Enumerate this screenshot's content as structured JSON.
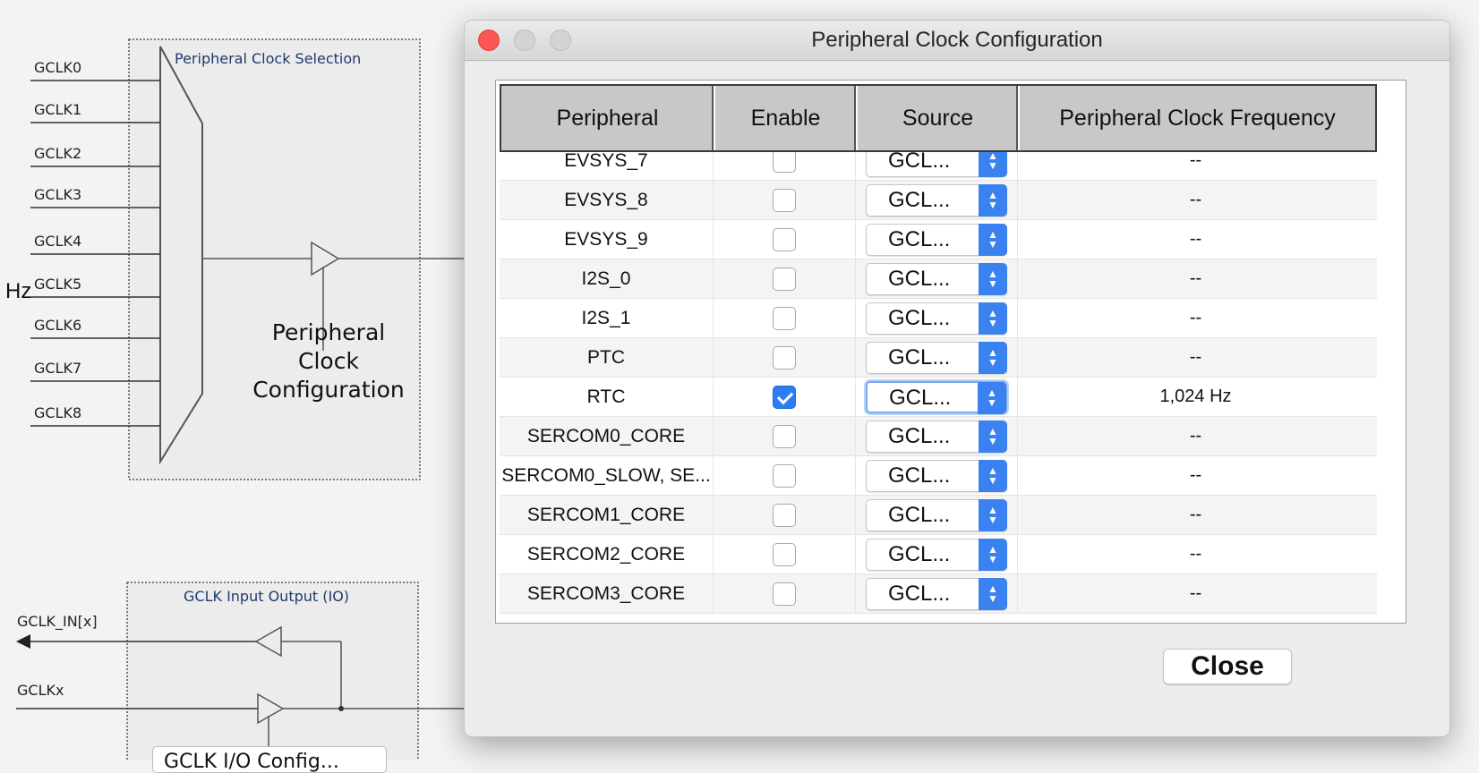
{
  "diagram": {
    "gclk_inputs": [
      "GCLK0",
      "GCLK1",
      "GCLK2",
      "GCLK3",
      "GCLK4",
      "GCLK5",
      "GCLK6",
      "GCLK7",
      "GCLK8"
    ],
    "selection_title": "Peripheral Clock Selection",
    "config_label_line1": "Peripheral",
    "config_label_line2": "Clock",
    "config_label_line3": "Configuration",
    "hz_fragment": "Hz",
    "io_title": "GCLK Input Output (IO)",
    "io_in_label": "GCLK_IN[x]",
    "io_out_label": "GCLKx",
    "io_config_button": "GCLK I/O Config..."
  },
  "dialog": {
    "title": "Peripheral Clock Configuration",
    "close_button": "Close",
    "columns": {
      "peripheral": "Peripheral",
      "enable": "Enable",
      "source": "Source",
      "frequency": "Peripheral Clock Frequency"
    },
    "rows": [
      {
        "peripheral": "EVSYS_7",
        "enabled": false,
        "source": "GCL...",
        "frequency": "--"
      },
      {
        "peripheral": "EVSYS_8",
        "enabled": false,
        "source": "GCL...",
        "frequency": "--"
      },
      {
        "peripheral": "EVSYS_9",
        "enabled": false,
        "source": "GCL...",
        "frequency": "--"
      },
      {
        "peripheral": "I2S_0",
        "enabled": false,
        "source": "GCL...",
        "frequency": "--"
      },
      {
        "peripheral": "I2S_1",
        "enabled": false,
        "source": "GCL...",
        "frequency": "--"
      },
      {
        "peripheral": "PTC",
        "enabled": false,
        "source": "GCL...",
        "frequency": "--"
      },
      {
        "peripheral": "RTC",
        "enabled": true,
        "source": "GCL...",
        "frequency": "1,024 Hz"
      },
      {
        "peripheral": "SERCOM0_CORE",
        "enabled": false,
        "source": "GCL...",
        "frequency": "--"
      },
      {
        "peripheral": "SERCOM0_SLOW, SE...",
        "enabled": false,
        "source": "GCL...",
        "frequency": "--"
      },
      {
        "peripheral": "SERCOM1_CORE",
        "enabled": false,
        "source": "GCL...",
        "frequency": "--"
      },
      {
        "peripheral": "SERCOM2_CORE",
        "enabled": false,
        "source": "GCL...",
        "frequency": "--"
      },
      {
        "peripheral": "SERCOM3_CORE",
        "enabled": false,
        "source": "GCL...",
        "frequency": "--"
      }
    ]
  },
  "colors": {
    "accent": "#3b82f1",
    "close_light": "#fc5753",
    "diagram_blue_text": "#1f3a6e"
  }
}
